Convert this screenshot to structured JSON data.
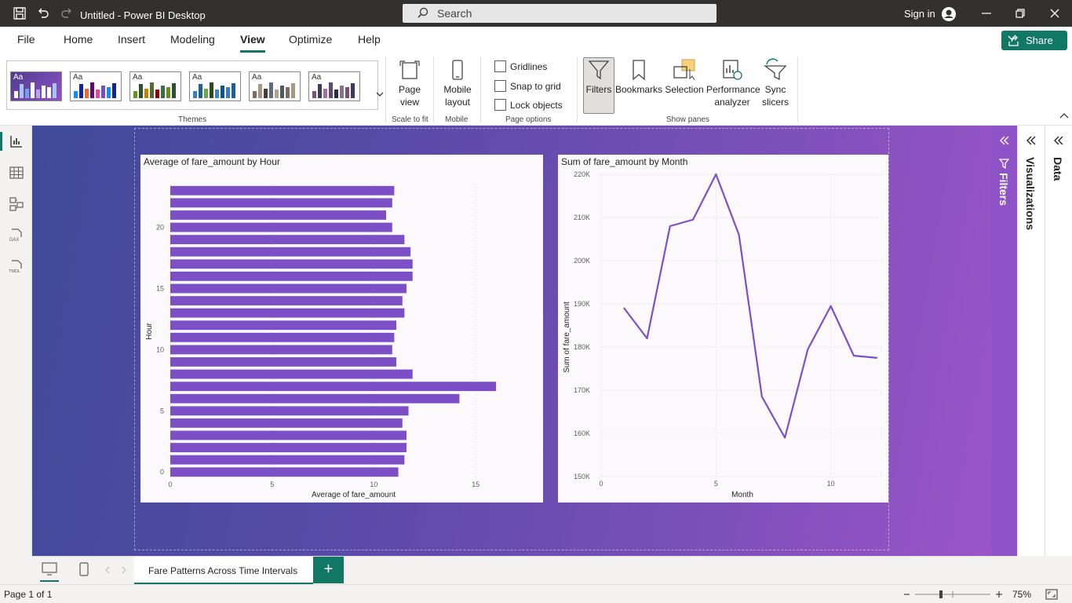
{
  "window": {
    "title": "Untitled - Power BI Desktop",
    "signin": "Sign in"
  },
  "search": {
    "label": "Search"
  },
  "menu": [
    {
      "label": "File"
    },
    {
      "label": "Home"
    },
    {
      "label": "Insert"
    },
    {
      "label": "Modeling"
    },
    {
      "label": "View"
    },
    {
      "label": "Optimize"
    },
    {
      "label": "Help"
    }
  ],
  "share": {
    "label": "Share"
  },
  "ribbon": {
    "themes_label": "Themes",
    "theme_aa": "Aa",
    "page_view": "Page view",
    "scale_label": "Scale to fit",
    "mobile_layout": "Mobile layout",
    "mobile_label": "Mobile",
    "gridlines": "Gridlines",
    "snap": "Snap to grid",
    "lock": "Lock objects",
    "page_options_label": "Page options",
    "filters": "Filters",
    "bookmarks": "Bookmarks",
    "selection": "Selection",
    "performance": "Performance analyzer",
    "sync": "Sync slicers",
    "show_panes_label": "Show panes"
  },
  "panes": {
    "filters": "Filters",
    "visualizations": "Visualizations",
    "data": "Data"
  },
  "tabs": {
    "page": "Fare Patterns Across Time Intervals",
    "add": "+"
  },
  "status": {
    "page": "Page 1 of 1",
    "zoom": "75%"
  },
  "colors": {
    "accent": "#117865",
    "series": "#7d4fc7"
  },
  "chart_data": [
    {
      "type": "bar",
      "orientation": "horizontal",
      "title": "Average of fare_amount by Hour",
      "xlabel": "Average of fare_amount",
      "ylabel": "Hour",
      "categories": [
        0,
        1,
        2,
        3,
        4,
        5,
        6,
        7,
        8,
        9,
        10,
        11,
        12,
        13,
        14,
        15,
        16,
        17,
        18,
        19,
        20,
        21,
        22,
        23
      ],
      "values": [
        11.2,
        11.5,
        11.6,
        11.6,
        11.4,
        11.7,
        14.2,
        16.0,
        11.9,
        11.1,
        10.9,
        11.0,
        11.1,
        11.5,
        11.4,
        11.6,
        11.9,
        11.9,
        11.8,
        11.5,
        10.9,
        10.6,
        10.9,
        11.0
      ],
      "xticks": [
        0,
        5,
        10,
        15
      ],
      "yticks": [
        0,
        5,
        10,
        15,
        20
      ],
      "xlim": [
        0,
        18
      ],
      "grid": true
    },
    {
      "type": "line",
      "title": "Sum of fare_amount by Month",
      "xlabel": "Month",
      "ylabel": "Sum of fare_amount",
      "x": [
        1,
        2,
        3,
        4,
        5,
        6,
        7,
        8,
        9,
        10,
        11,
        12
      ],
      "y": [
        189000,
        182000,
        208000,
        209500,
        220000,
        206000,
        168500,
        159000,
        179500,
        189500,
        178000,
        177500
      ],
      "xticks": [
        0,
        5,
        10
      ],
      "yticks": [
        150000,
        160000,
        170000,
        180000,
        190000,
        200000,
        210000,
        220000
      ],
      "ytick_labels": [
        "150K",
        "160K",
        "170K",
        "180K",
        "190K",
        "200K",
        "210K",
        "220K"
      ],
      "xlim": [
        0,
        12.3
      ],
      "ylim": [
        150000,
        220000
      ],
      "grid": true
    }
  ]
}
